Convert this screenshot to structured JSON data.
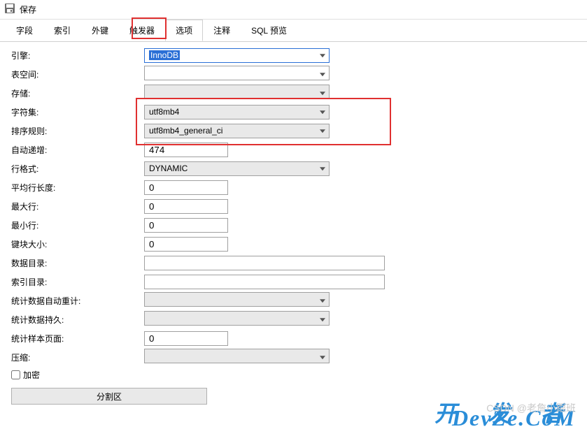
{
  "header": {
    "save_label": "保存"
  },
  "tabs": {
    "fields": "字段",
    "indexes": "索引",
    "foreign_keys": "外键",
    "triggers": "触发器",
    "options": "选项",
    "comment": "注释",
    "sql_preview": "SQL 预览"
  },
  "form": {
    "engine_label": "引擎:",
    "engine_value": "InnoDB",
    "tablespace_label": "表空间:",
    "tablespace_value": "",
    "storage_label": "存储:",
    "storage_value": "",
    "charset_label": "字符集:",
    "charset_value": "utf8mb4",
    "collation_label": "排序规则:",
    "collation_value": "utf8mb4_general_ci",
    "autoinc_label": "自动递增:",
    "autoinc_value": "474",
    "rowformat_label": "行格式:",
    "rowformat_value": "DYNAMIC",
    "avgrowlen_label": "平均行长度:",
    "avgrowlen_value": "0",
    "maxrows_label": "最大行:",
    "maxrows_value": "0",
    "minrows_label": "最小行:",
    "minrows_value": "0",
    "keyblock_label": "键块大小:",
    "keyblock_value": "0",
    "datadir_label": "数据目录:",
    "datadir_value": "",
    "indexdir_label": "索引目录:",
    "indexdir_value": "",
    "stats_recalc_label": "统计数据自动重计:",
    "stats_recalc_value": "",
    "stats_persist_label": "统计数据持久:",
    "stats_persist_value": "",
    "stats_sample_label": "统计样本页面:",
    "stats_sample_value": "0",
    "compress_label": "压缩:",
    "compress_value": "",
    "encrypt_label": "加密",
    "partition_btn": "分割区"
  },
  "watermark": {
    "top": "开 发 者",
    "main": "DevZe.CoM",
    "csdn": "CSDN @老詹小跟班"
  }
}
